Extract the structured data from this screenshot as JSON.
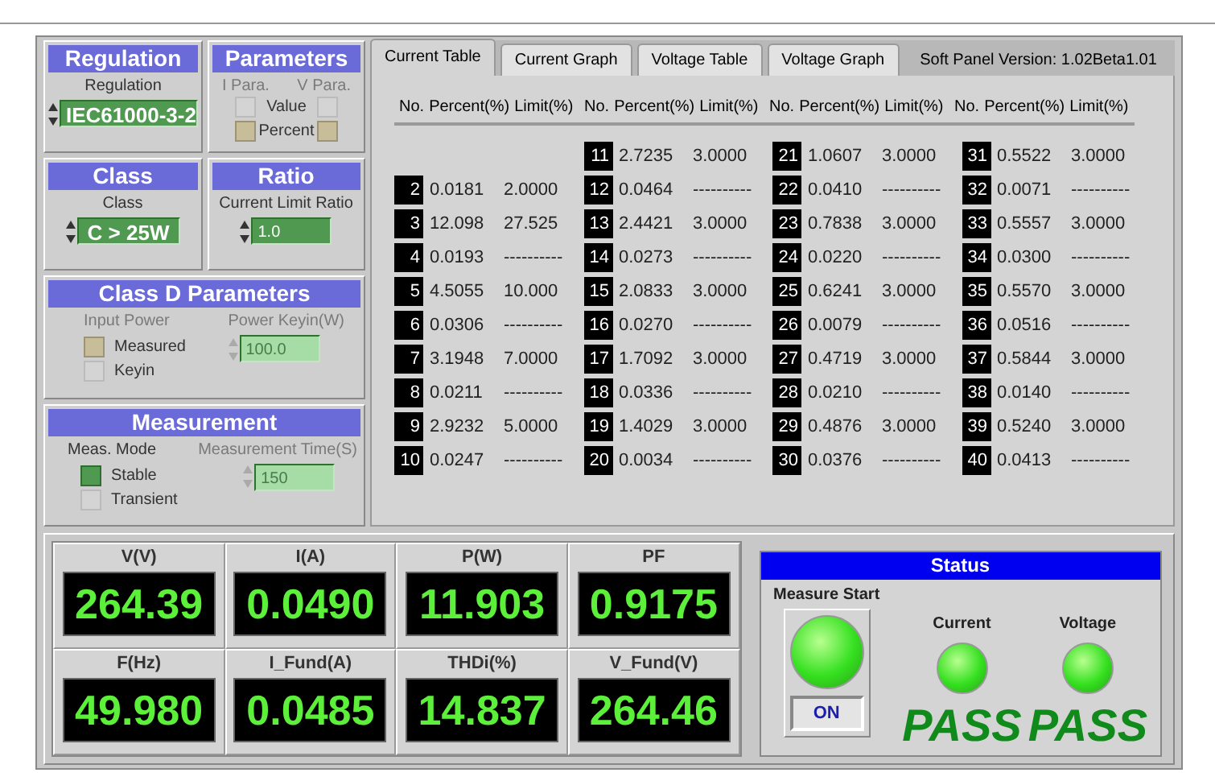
{
  "regulation": {
    "title": "Regulation",
    "label": "Regulation",
    "value": "IEC61000-3-2"
  },
  "parameters": {
    "title": "Parameters",
    "disabled": true,
    "options": [
      "Value",
      "Percent"
    ],
    "selectors": [
      {
        "label": "I Para.",
        "choices": [
          {
            "selected": false
          },
          {
            "selected": true
          }
        ]
      },
      {
        "label": "V Para.",
        "choices": [
          {
            "selected": false
          },
          {
            "selected": true
          }
        ]
      }
    ]
  },
  "class": {
    "title": "Class",
    "label": "Class",
    "value": "C > 25W"
  },
  "ratio": {
    "title": "Ratio",
    "label": "Current Limit Ratio",
    "value": "1.0"
  },
  "class_d": {
    "title": "Class D Parameters",
    "input_power": {
      "label": "Input Power",
      "disabled": true,
      "options": [
        {
          "label": "Measured",
          "selected": true
        },
        {
          "label": "Keyin",
          "selected": false
        }
      ]
    },
    "power_keyin": {
      "label": "Power Keyin(W)",
      "value": "100.0",
      "disabled": true
    }
  },
  "measurement": {
    "title": "Measurement",
    "mode": {
      "label": "Meas. Mode",
      "disabled": false,
      "options": [
        {
          "label": "Stable",
          "selected": true
        },
        {
          "label": "Transient",
          "selected": false
        }
      ]
    },
    "time": {
      "label": "Measurement Time(S)",
      "value": "150",
      "disabled": true
    }
  },
  "tabs": [
    {
      "label": "Current Table",
      "selected": true
    },
    {
      "label": "Current Graph",
      "selected": false
    },
    {
      "label": "Voltage Table",
      "selected": false
    },
    {
      "label": "Voltage Graph",
      "selected": false
    }
  ],
  "version": "Soft Panel Version:  1.02Beta1.01",
  "table": {
    "headers": [
      [
        "No.",
        "Percent(%)",
        "Limit(%)"
      ],
      [
        "No.",
        "Percent(%)",
        "Limit(%)"
      ],
      [
        "No.",
        "Percent(%)",
        "Limit(%)"
      ],
      [
        "No.",
        "Percent(%)",
        "Limit(%)"
      ]
    ],
    "groups": [
      [
        {
          "no": "2",
          "percent": "0.0181",
          "limit": "2.0000"
        },
        {
          "no": "3",
          "percent": "12.098",
          "limit": "27.525"
        },
        {
          "no": "4",
          "percent": "0.0193",
          "limit": "----------"
        },
        {
          "no": "5",
          "percent": "4.5055",
          "limit": "10.000"
        },
        {
          "no": "6",
          "percent": "0.0306",
          "limit": "----------"
        },
        {
          "no": "7",
          "percent": "3.1948",
          "limit": "7.0000"
        },
        {
          "no": "8",
          "percent": "0.0211",
          "limit": "----------"
        },
        {
          "no": "9",
          "percent": "2.9232",
          "limit": "5.0000"
        },
        {
          "no": "10",
          "percent": "0.0247",
          "limit": "----------"
        }
      ],
      [
        {
          "no": "11",
          "percent": "2.7235",
          "limit": "3.0000"
        },
        {
          "no": "12",
          "percent": "0.0464",
          "limit": "----------"
        },
        {
          "no": "13",
          "percent": "2.4421",
          "limit": "3.0000"
        },
        {
          "no": "14",
          "percent": "0.0273",
          "limit": "----------"
        },
        {
          "no": "15",
          "percent": "2.0833",
          "limit": "3.0000"
        },
        {
          "no": "16",
          "percent": "0.0270",
          "limit": "----------"
        },
        {
          "no": "17",
          "percent": "1.7092",
          "limit": "3.0000"
        },
        {
          "no": "18",
          "percent": "0.0336",
          "limit": "----------"
        },
        {
          "no": "19",
          "percent": "1.4029",
          "limit": "3.0000"
        },
        {
          "no": "20",
          "percent": "0.0034",
          "limit": "----------"
        }
      ],
      [
        {
          "no": "21",
          "percent": "1.0607",
          "limit": "3.0000"
        },
        {
          "no": "22",
          "percent": "0.0410",
          "limit": "----------"
        },
        {
          "no": "23",
          "percent": "0.7838",
          "limit": "3.0000"
        },
        {
          "no": "24",
          "percent": "0.0220",
          "limit": "----------"
        },
        {
          "no": "25",
          "percent": "0.6241",
          "limit": "3.0000"
        },
        {
          "no": "26",
          "percent": "0.0079",
          "limit": "----------"
        },
        {
          "no": "27",
          "percent": "0.4719",
          "limit": "3.0000"
        },
        {
          "no": "28",
          "percent": "0.0210",
          "limit": "----------"
        },
        {
          "no": "29",
          "percent": "0.4876",
          "limit": "3.0000"
        },
        {
          "no": "30",
          "percent": "0.0376",
          "limit": "----------"
        }
      ],
      [
        {
          "no": "31",
          "percent": "0.5522",
          "limit": "3.0000"
        },
        {
          "no": "32",
          "percent": "0.0071",
          "limit": "----------"
        },
        {
          "no": "33",
          "percent": "0.5557",
          "limit": "3.0000"
        },
        {
          "no": "34",
          "percent": "0.0300",
          "limit": "----------"
        },
        {
          "no": "35",
          "percent": "0.5570",
          "limit": "3.0000"
        },
        {
          "no": "36",
          "percent": "0.0516",
          "limit": "----------"
        },
        {
          "no": "37",
          "percent": "0.5844",
          "limit": "3.0000"
        },
        {
          "no": "38",
          "percent": "0.0140",
          "limit": "----------"
        },
        {
          "no": "39",
          "percent": "0.5240",
          "limit": "3.0000"
        },
        {
          "no": "40",
          "percent": "0.0413",
          "limit": "----------"
        }
      ]
    ]
  },
  "meters": [
    {
      "label": "V(V)",
      "value": "264.39"
    },
    {
      "label": "I(A)",
      "value": "0.0490"
    },
    {
      "label": "P(W)",
      "value": "11.903"
    },
    {
      "label": "PF",
      "value": "0.9175"
    },
    {
      "label": "F(Hz)",
      "value": "49.980"
    },
    {
      "label": "I_Fund(A)",
      "value": "0.0485"
    },
    {
      "label": "THDi(%)",
      "value": "14.837"
    },
    {
      "label": "V_Fund(V)",
      "value": "264.46"
    }
  ],
  "status": {
    "title": "Status",
    "measure_start": {
      "label": "Measure Start",
      "on": true,
      "button_text": "ON"
    },
    "indicators": [
      {
        "label": "Current",
        "pass": true,
        "result": "PASS"
      },
      {
        "label": "Voltage",
        "pass": true,
        "result": "PASS"
      }
    ]
  }
}
